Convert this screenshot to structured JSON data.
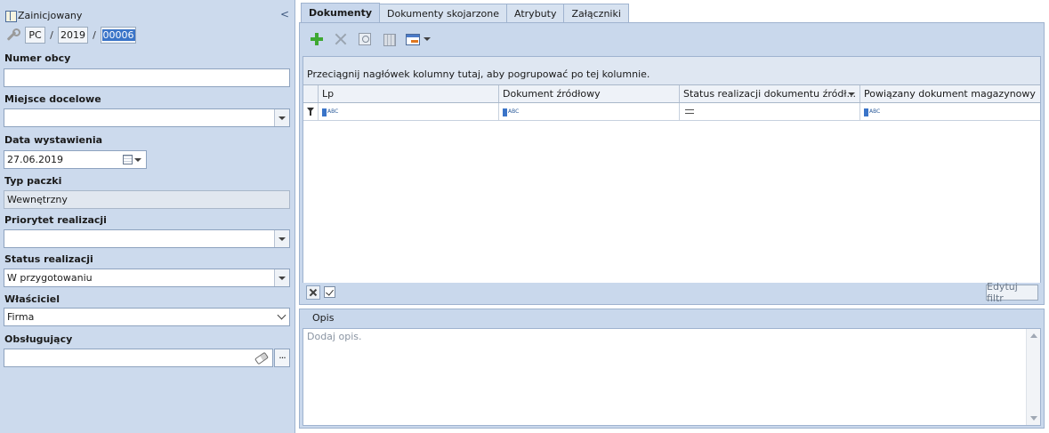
{
  "header": {
    "status": "Zainicjowany",
    "collapse_glyph": "<"
  },
  "number": {
    "prefix": "PC",
    "sep1": "/",
    "year": "2019",
    "sep2": "/",
    "counter": "00006"
  },
  "fields": {
    "numer_obcy": {
      "label": "Numer obcy",
      "value": ""
    },
    "miejsce_docelowe": {
      "label": "Miejsce docelowe",
      "value": ""
    },
    "data_wystawienia": {
      "label": "Data wystawienia",
      "value": "27.06.2019"
    },
    "typ_paczki": {
      "label": "Typ paczki",
      "value": "Wewnętrzny"
    },
    "priorytet": {
      "label": "Priorytet realizacji",
      "value": ""
    },
    "status_realizacji": {
      "label": "Status realizacji",
      "value": "W przygotowaniu"
    },
    "wlasciciel": {
      "label": "Właściciel",
      "value": "Firma"
    },
    "obslugujacy": {
      "label": "Obsługujący",
      "value": "",
      "more_glyph": "···"
    }
  },
  "tabs": [
    {
      "label": "Dokumenty",
      "active": true
    },
    {
      "label": "Dokumenty skojarzone",
      "active": false
    },
    {
      "label": "Atrybuty",
      "active": false
    },
    {
      "label": "Załączniki",
      "active": false
    }
  ],
  "toolbar": {
    "icons": [
      "plus-icon",
      "delete-icon",
      "preview-icon",
      "dismantle-icon",
      "export-icon"
    ]
  },
  "grid": {
    "group_hint": "Przeciągnij nagłówek kolumny tutaj, aby pogrupować po tej kolumnie.",
    "columns": [
      "Lp",
      "Dokument źródłowy",
      "Status realizacji dokumentu źródł...",
      "Powiązany dokument magazynowy"
    ],
    "filter_row_glyph": "ABC"
  },
  "filter_bar": {
    "edit_label": "Edytuj filtr"
  },
  "opis": {
    "title": "Opis",
    "placeholder": "Dodaj opis."
  },
  "colors": {
    "panel_bg": "#ccdaed",
    "accent": "#3a74c8",
    "add_green": "#3ea832"
  }
}
